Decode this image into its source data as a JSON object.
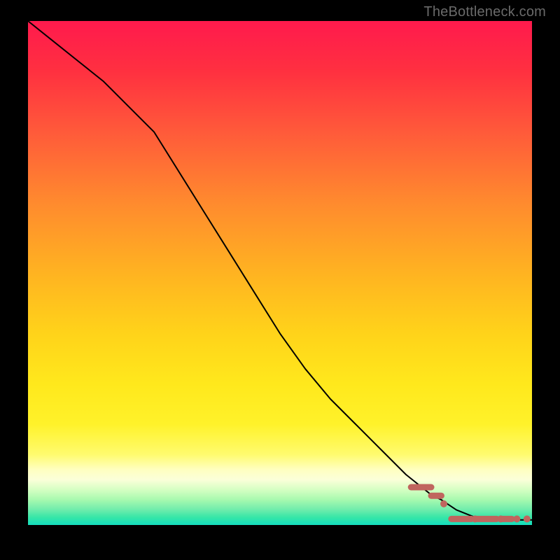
{
  "watermark": "TheBottleneck.com",
  "chart_data": {
    "type": "line",
    "title": "",
    "xlabel": "",
    "ylabel": "",
    "xlim": [
      0,
      100
    ],
    "ylim": [
      0,
      100
    ],
    "curve": {
      "x": [
        0,
        5,
        10,
        15,
        20,
        25,
        30,
        35,
        40,
        45,
        50,
        55,
        60,
        65,
        70,
        75,
        80,
        82,
        85,
        90,
        95,
        100
      ],
      "y": [
        100,
        96,
        92,
        88,
        83,
        78,
        70,
        62,
        54,
        46,
        38,
        31,
        25,
        20,
        15,
        10,
        6,
        5,
        3,
        1,
        1,
        1
      ]
    },
    "markers": {
      "color": "#c0655e",
      "dashes": [
        {
          "x0": 76,
          "x1": 80,
          "y": 7.5
        },
        {
          "x0": 80,
          "x1": 82,
          "y": 5.8
        },
        {
          "x0": 84,
          "x1": 88,
          "y": 1.2
        },
        {
          "x0": 89,
          "x1": 93,
          "y": 1.2
        },
        {
          "x0": 94,
          "x1": 96,
          "y": 1.2
        }
      ],
      "points": [
        {
          "x": 82.5,
          "y": 4.2
        },
        {
          "x": 88.7,
          "y": 1.2
        },
        {
          "x": 93.8,
          "y": 1.2
        },
        {
          "x": 97.0,
          "y": 1.2
        },
        {
          "x": 99.0,
          "y": 1.2
        }
      ]
    }
  }
}
